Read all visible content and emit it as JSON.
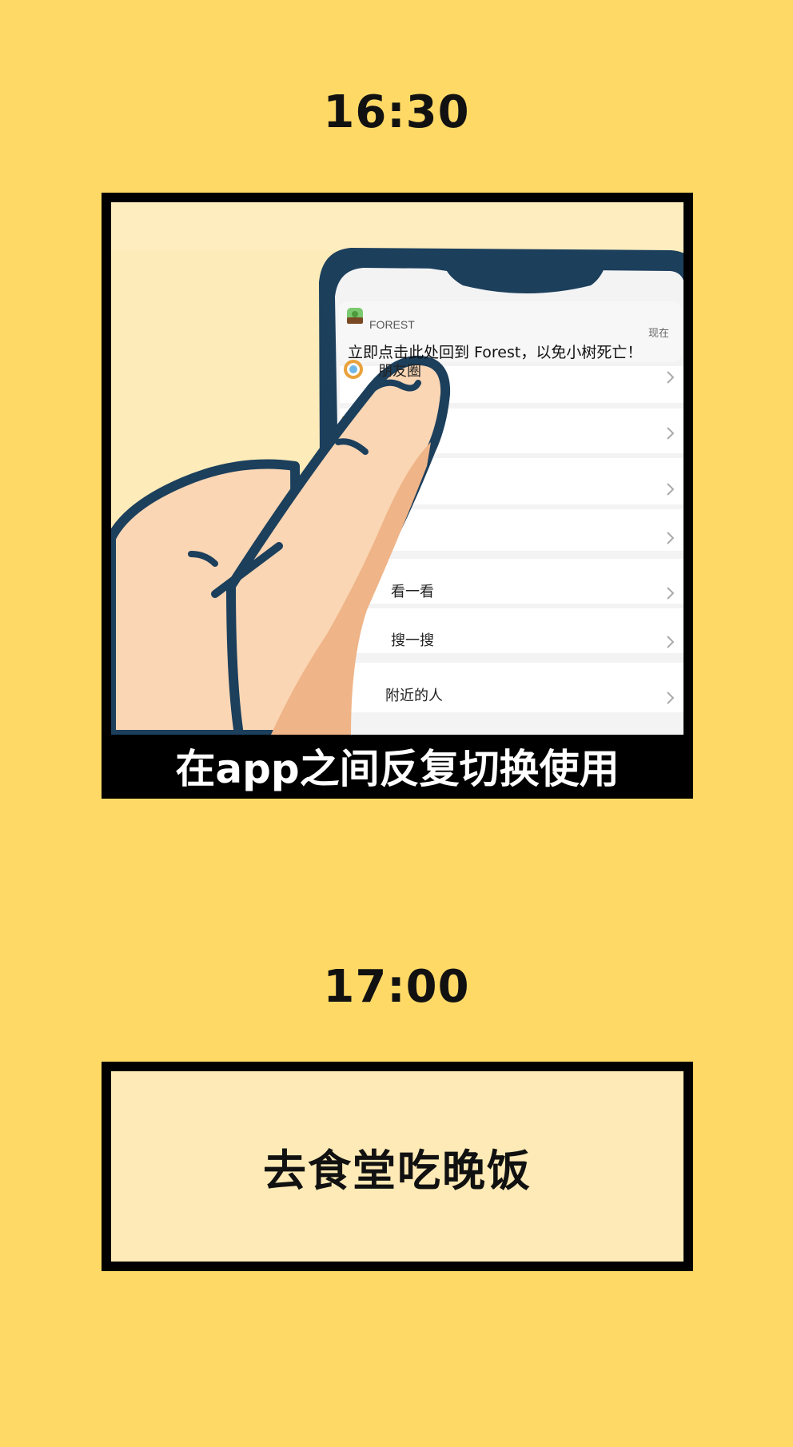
{
  "timeline": [
    {
      "time": "16:30",
      "caption": "在app之间反复切换使用",
      "illustration": {
        "icon": "hand-pressing-phone-illustration",
        "notification": {
          "app_name": "FOREST",
          "time_label": "现在",
          "message": "立即点击此处回到 Forest，以免小树死亡！"
        },
        "list_items": [
          "朋友圈",
          "看一看",
          "搜一搜",
          "附近的人"
        ]
      }
    },
    {
      "time": "17:00",
      "activity": "去食堂吃晚饭"
    }
  ],
  "colors": {
    "background": "#FED966",
    "frame": "#000000",
    "panel_fill": "#FDEBB9",
    "phone_dark": "#1C3F5C",
    "skin": "#FAD6B4",
    "skin_shadow": "#EFB487"
  }
}
